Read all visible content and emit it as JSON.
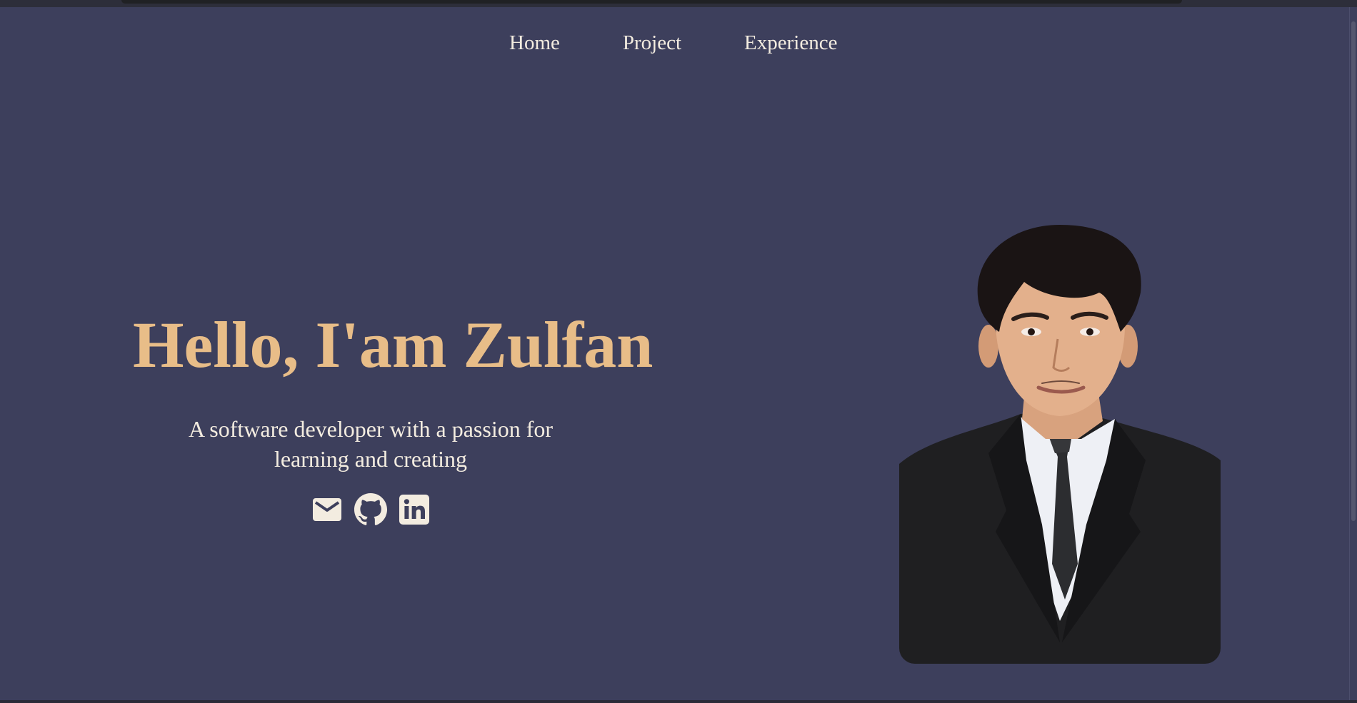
{
  "nav": {
    "items": [
      {
        "label": "Home"
      },
      {
        "label": "Project"
      },
      {
        "label": "Experience"
      }
    ]
  },
  "hero": {
    "title": "Hello, I'am Zulfan",
    "subtitle_line1": "A software developer with a passion for",
    "subtitle_line2": "learning and creating"
  },
  "socials": [
    {
      "icon": "mail-icon"
    },
    {
      "icon": "github-icon"
    },
    {
      "icon": "linkedin-icon"
    }
  ],
  "colors": {
    "background": "#3d3f5c",
    "accent": "#e8bd88",
    "text": "#f3ece0"
  }
}
